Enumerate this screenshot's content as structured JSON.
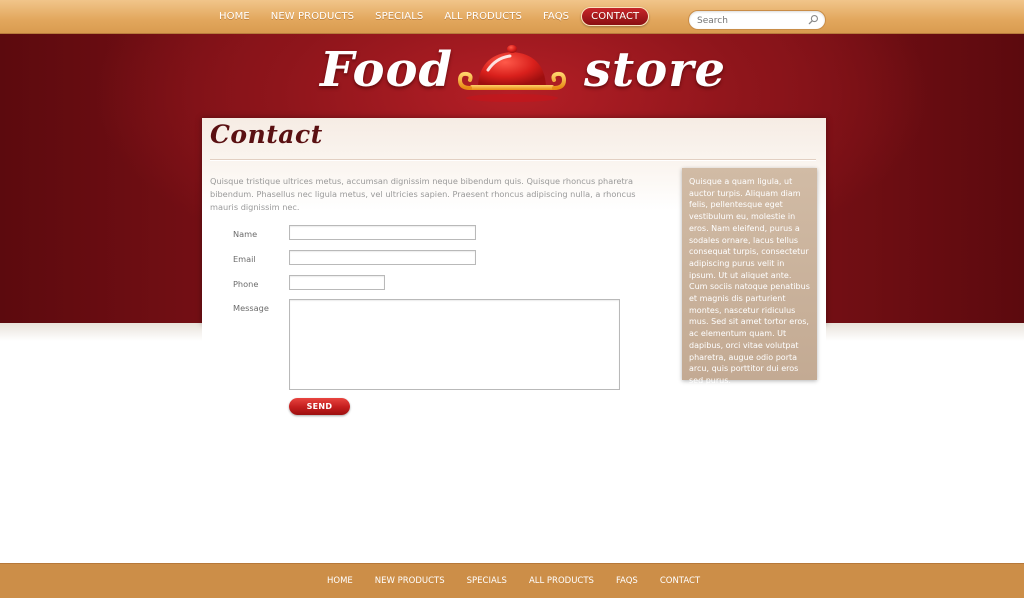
{
  "top_nav": {
    "items": [
      {
        "label": "HOME"
      },
      {
        "label": "NEW PRODUCTS"
      },
      {
        "label": "SPECIALS"
      },
      {
        "label": "ALL PRODUCTS"
      },
      {
        "label": "FAQS"
      },
      {
        "label": "CONTACT",
        "active": true
      }
    ]
  },
  "search": {
    "placeholder": "Search",
    "icon": "magnifier-icon"
  },
  "logo": {
    "word1": "Food",
    "word2": "store",
    "icon": "cloche-icon"
  },
  "page": {
    "title": "Contact",
    "intro": "Quisque tristique ultrices metus, accumsan dignissim neque bibendum quis. Quisque rhoncus pharetra bibendum. Phasellus nec ligula metus, vel ultricies sapien. Praesent rhoncus adipiscing nulla, a rhoncus mauris dignissim nec."
  },
  "form": {
    "name_label": "Name",
    "email_label": "Email",
    "phone_label": "Phone",
    "message_label": "Message",
    "name_value": "",
    "email_value": "",
    "phone_value": "",
    "message_value": "",
    "send_label": "SEND"
  },
  "sidebar": {
    "text": "Quisque a quam ligula, ut auctor turpis. Aliquam diam felis, pellentesque eget vestibulum eu, molestie in eros. Nam eleifend, purus a sodales ornare, lacus tellus consequat turpis, consectetur adipiscing purus velit in ipsum. Ut ut aliquet ante. Cum sociis natoque penatibus et magnis dis parturient montes, nascetur ridiculus mus. Sed sit amet tortor eros, ac elementum quam. Ut dapibus, orci vitae volutpat pharetra, augue odio porta arcu, quis porttitor dui eros sed purus."
  },
  "footer_nav": {
    "items": [
      {
        "label": "HOME"
      },
      {
        "label": "NEW PRODUCTS"
      },
      {
        "label": "SPECIALS"
      },
      {
        "label": "ALL PRODUCTS"
      },
      {
        "label": "FAQS"
      },
      {
        "label": "CONTACT"
      }
    ]
  },
  "colors": {
    "nav_bar": "#e2a75d",
    "banner_red": "#8c141a",
    "active_tab": "#a8181c",
    "title_brown": "#5a1012",
    "sidebar_tan": "#c9b29c",
    "footer": "#cc8e48",
    "send_button": "#c31d1d"
  }
}
